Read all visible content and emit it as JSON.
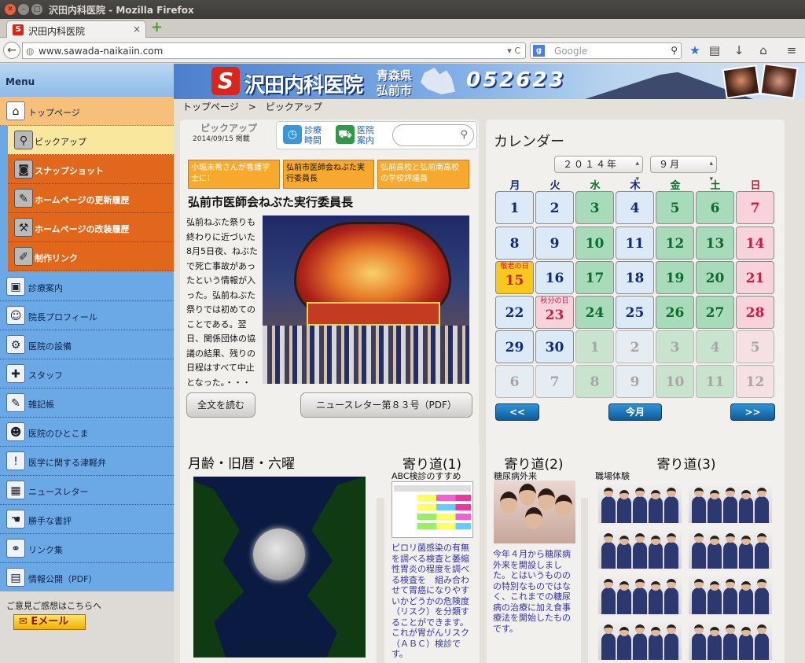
{
  "browser": {
    "window_title": "沢田内科医院 - Mozilla Firefox",
    "tab_label": "沢田内科医院",
    "favicon_letter": "S",
    "url": "www.sawada-naikaiin.com",
    "search_placeholder": "Google",
    "search_engine_letter": "g"
  },
  "banner": {
    "clinic_name": "沢田内科医院",
    "pref": "青森県",
    "city": "弘前市",
    "zip": "052623"
  },
  "breadcrumb": "トップページ　>　ピックアップ",
  "sidebar": {
    "header": "Menu",
    "top_items": [
      {
        "label": "トップページ"
      }
    ],
    "sub_items": [
      {
        "label": "ピックアップ"
      },
      {
        "label": "スナップショット"
      },
      {
        "label": "ホームページの更新履歴"
      },
      {
        "label": "ホームページの改装履歴"
      },
      {
        "label": "制作リンク"
      }
    ],
    "blue_items": [
      {
        "label": "診療案内"
      },
      {
        "label": "院長プロフィール"
      },
      {
        "label": "医院の設備"
      },
      {
        "label": "スタッフ"
      },
      {
        "label": "雑記帳"
      },
      {
        "label": "医院のひとこま"
      },
      {
        "label": "医学に関する津軽弁"
      },
      {
        "label": "ニュースレター"
      },
      {
        "label": "勝手な書評"
      },
      {
        "label": "リンク集"
      },
      {
        "label": "情報公開（PDF）"
      }
    ],
    "opinion_text": "ご意見ご感想はこちらへ",
    "email_label": "Eメール"
  },
  "pickup": {
    "tab_title": "ピックアップ",
    "tab_date": "2014/09/15 掲載",
    "nav_shinryo": "診療\n時間",
    "nav_annai": "医院\n案内",
    "news": [
      "小堀未希さんが看護学士に！",
      "弘前市医師会ねぶた実行委員長",
      "弘前高校と弘前南高校の学校評議員"
    ],
    "title": "弘前市医師会ねぶた実行委員長",
    "body": "弘前ねぶた祭りも終わりに近づいた8月5日夜、ねぶたで死亡事故があったという情報が入った。弘前ねぶた祭りでは初めてのことである。翌日、関係団体の協議の結果、残りの日程はすべて中止となった。・・・",
    "read_more": "全文を読む",
    "newsletter": "ニュースレター第８３号（PDF）"
  },
  "calendar": {
    "title": "カレンダー",
    "year_select": "２０１４年",
    "month_select": "９月",
    "dow": [
      "月",
      "火",
      "水",
      "木",
      "金",
      "土",
      "日"
    ],
    "rows": [
      [
        "1",
        "2",
        "3",
        "4",
        "5",
        "6",
        "7"
      ],
      [
        "8",
        "9",
        "10",
        "11",
        "12",
        "13",
        "14"
      ],
      [
        "15",
        "16",
        "17",
        "18",
        "19",
        "20",
        "21"
      ],
      [
        "22",
        "23",
        "24",
        "25",
        "26",
        "27",
        "28"
      ],
      [
        "29",
        "30",
        "1",
        "2",
        "3",
        "4",
        "5"
      ],
      [
        "6",
        "7",
        "8",
        "9",
        "10",
        "11",
        "12"
      ]
    ],
    "holiday_labels": {
      "15": "敬老の日",
      "23": "秋分の日"
    },
    "prev": "<<",
    "today": "今月",
    "next": ">>",
    "colors": {
      "weekday": "#dce9f7",
      "wednesday": "#a7dbb9",
      "friday": "#a7dbb9",
      "saturday": "#a7dbb9",
      "sunday": "#f8d3dc",
      "holiday": "#f8d3dc",
      "today": "#f8c81e",
      "weekday_text": "#102a7a",
      "green_text": "#0d6b2e",
      "red_text": "#d01a3c"
    }
  },
  "moon": {
    "title": "月齢・旧暦・六曜"
  },
  "yori1": {
    "title": "寄り道(1)",
    "sub": "ABC検診のすすめ",
    "text": "ピロリ菌感染の有無を調べる検査と萎縮性胃炎の程度を調べる検査を　組み合わせて胃癌になりやすいかどうかの危険度（リスク）を分類することができます。これが胃がんリスク（ＡＢＣ）検診です。"
  },
  "yori2": {
    "title": "寄り道(2)",
    "sub": "糖尿病外来",
    "text": "今年４月から糖尿病外来を開設しました。とはいうもののの特別なものではなく、これまでの糖尿病の治療に加え食事療法を開始したものです。"
  },
  "yori3": {
    "title": "寄り道(3)",
    "sub": "職場体験"
  }
}
